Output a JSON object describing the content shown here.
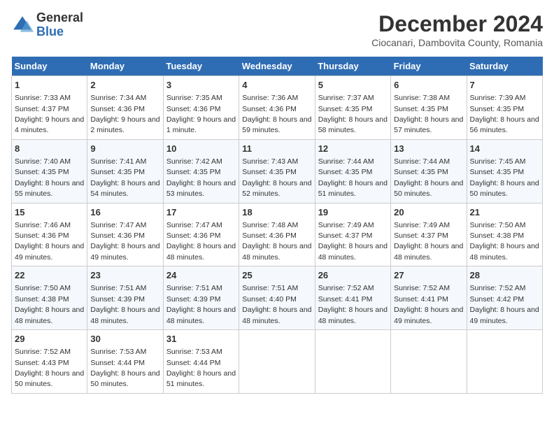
{
  "logo": {
    "general": "General",
    "blue": "Blue"
  },
  "header": {
    "title": "December 2024",
    "subtitle": "Ciocanari, Dambovita County, Romania"
  },
  "weekdays": [
    "Sunday",
    "Monday",
    "Tuesday",
    "Wednesday",
    "Thursday",
    "Friday",
    "Saturday"
  ],
  "weeks": [
    [
      {
        "day": "1",
        "sunrise": "7:33 AM",
        "sunset": "4:37 PM",
        "daylight": "9 hours and 4 minutes."
      },
      {
        "day": "2",
        "sunrise": "7:34 AM",
        "sunset": "4:36 PM",
        "daylight": "9 hours and 2 minutes."
      },
      {
        "day": "3",
        "sunrise": "7:35 AM",
        "sunset": "4:36 PM",
        "daylight": "9 hours and 1 minute."
      },
      {
        "day": "4",
        "sunrise": "7:36 AM",
        "sunset": "4:36 PM",
        "daylight": "8 hours and 59 minutes."
      },
      {
        "day": "5",
        "sunrise": "7:37 AM",
        "sunset": "4:35 PM",
        "daylight": "8 hours and 58 minutes."
      },
      {
        "day": "6",
        "sunrise": "7:38 AM",
        "sunset": "4:35 PM",
        "daylight": "8 hours and 57 minutes."
      },
      {
        "day": "7",
        "sunrise": "7:39 AM",
        "sunset": "4:35 PM",
        "daylight": "8 hours and 56 minutes."
      }
    ],
    [
      {
        "day": "8",
        "sunrise": "7:40 AM",
        "sunset": "4:35 PM",
        "daylight": "8 hours and 55 minutes."
      },
      {
        "day": "9",
        "sunrise": "7:41 AM",
        "sunset": "4:35 PM",
        "daylight": "8 hours and 54 minutes."
      },
      {
        "day": "10",
        "sunrise": "7:42 AM",
        "sunset": "4:35 PM",
        "daylight": "8 hours and 53 minutes."
      },
      {
        "day": "11",
        "sunrise": "7:43 AM",
        "sunset": "4:35 PM",
        "daylight": "8 hours and 52 minutes."
      },
      {
        "day": "12",
        "sunrise": "7:44 AM",
        "sunset": "4:35 PM",
        "daylight": "8 hours and 51 minutes."
      },
      {
        "day": "13",
        "sunrise": "7:44 AM",
        "sunset": "4:35 PM",
        "daylight": "8 hours and 50 minutes."
      },
      {
        "day": "14",
        "sunrise": "7:45 AM",
        "sunset": "4:35 PM",
        "daylight": "8 hours and 50 minutes."
      }
    ],
    [
      {
        "day": "15",
        "sunrise": "7:46 AM",
        "sunset": "4:36 PM",
        "daylight": "8 hours and 49 minutes."
      },
      {
        "day": "16",
        "sunrise": "7:47 AM",
        "sunset": "4:36 PM",
        "daylight": "8 hours and 49 minutes."
      },
      {
        "day": "17",
        "sunrise": "7:47 AM",
        "sunset": "4:36 PM",
        "daylight": "8 hours and 48 minutes."
      },
      {
        "day": "18",
        "sunrise": "7:48 AM",
        "sunset": "4:36 PM",
        "daylight": "8 hours and 48 minutes."
      },
      {
        "day": "19",
        "sunrise": "7:49 AM",
        "sunset": "4:37 PM",
        "daylight": "8 hours and 48 minutes."
      },
      {
        "day": "20",
        "sunrise": "7:49 AM",
        "sunset": "4:37 PM",
        "daylight": "8 hours and 48 minutes."
      },
      {
        "day": "21",
        "sunrise": "7:50 AM",
        "sunset": "4:38 PM",
        "daylight": "8 hours and 48 minutes."
      }
    ],
    [
      {
        "day": "22",
        "sunrise": "7:50 AM",
        "sunset": "4:38 PM",
        "daylight": "8 hours and 48 minutes."
      },
      {
        "day": "23",
        "sunrise": "7:51 AM",
        "sunset": "4:39 PM",
        "daylight": "8 hours and 48 minutes."
      },
      {
        "day": "24",
        "sunrise": "7:51 AM",
        "sunset": "4:39 PM",
        "daylight": "8 hours and 48 minutes."
      },
      {
        "day": "25",
        "sunrise": "7:51 AM",
        "sunset": "4:40 PM",
        "daylight": "8 hours and 48 minutes."
      },
      {
        "day": "26",
        "sunrise": "7:52 AM",
        "sunset": "4:41 PM",
        "daylight": "8 hours and 48 minutes."
      },
      {
        "day": "27",
        "sunrise": "7:52 AM",
        "sunset": "4:41 PM",
        "daylight": "8 hours and 49 minutes."
      },
      {
        "day": "28",
        "sunrise": "7:52 AM",
        "sunset": "4:42 PM",
        "daylight": "8 hours and 49 minutes."
      }
    ],
    [
      {
        "day": "29",
        "sunrise": "7:52 AM",
        "sunset": "4:43 PM",
        "daylight": "8 hours and 50 minutes."
      },
      {
        "day": "30",
        "sunrise": "7:53 AM",
        "sunset": "4:44 PM",
        "daylight": "8 hours and 50 minutes."
      },
      {
        "day": "31",
        "sunrise": "7:53 AM",
        "sunset": "4:44 PM",
        "daylight": "8 hours and 51 minutes."
      },
      null,
      null,
      null,
      null
    ]
  ]
}
